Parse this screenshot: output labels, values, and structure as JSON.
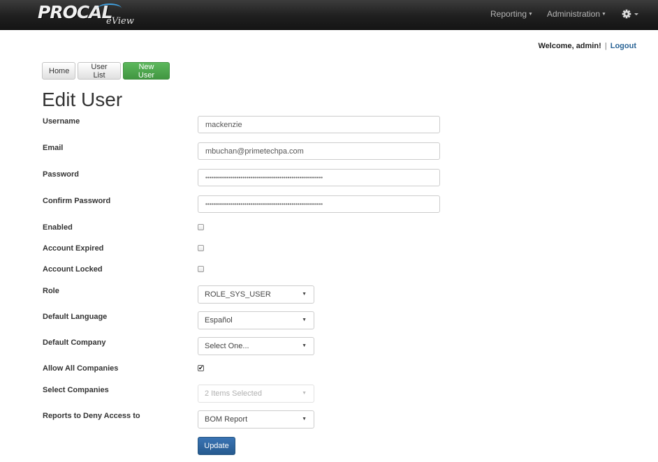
{
  "app": {
    "brand_pro": "PRO",
    "brand_cal": "CAL",
    "brand_sub": "eView"
  },
  "nav": {
    "reporting": "Reporting",
    "administration": "Administration",
    "settings_icon": "gear-icon"
  },
  "user_bar": {
    "welcome": "Welcome, admin!",
    "separator": "|",
    "logout": "Logout"
  },
  "actions": {
    "home": "Home",
    "user_list": "User List",
    "new_user": "New User"
  },
  "page": {
    "title": "Edit User"
  },
  "form": {
    "username_label": "Username",
    "username_value": "mackenzie",
    "email_label": "Email",
    "email_value": "mbuchan@primetechpa.com",
    "password_label": "Password",
    "password_value": "••••••••••••••••••••••••••••••••••••••••••••••••••••••••••••",
    "confirm_password_label": "Confirm Password",
    "confirm_password_value": "••••••••••••••••••••••••••••••••••••••••••••••••••••••••••••",
    "enabled_label": "Enabled",
    "enabled_checked": false,
    "account_expired_label": "Account Expired",
    "account_expired_checked": false,
    "account_locked_label": "Account Locked",
    "account_locked_checked": false,
    "role_label": "Role",
    "role_value": "ROLE_SYS_USER",
    "default_language_label": "Default Language",
    "default_language_value": "Español",
    "default_company_label": "Default Company",
    "default_company_value": "Select One...",
    "allow_all_companies_label": "Allow All Companies",
    "allow_all_companies_checked": true,
    "select_companies_label": "Select Companies",
    "select_companies_value": "2 Items Selected",
    "reports_deny_label": "Reports to Deny Access to",
    "reports_deny_value": "BOM Report",
    "update_button": "Update"
  },
  "colors": {
    "navbar": "#222222",
    "success": "#5cb85c",
    "primary": "#337ab7",
    "link": "#2a6496"
  }
}
